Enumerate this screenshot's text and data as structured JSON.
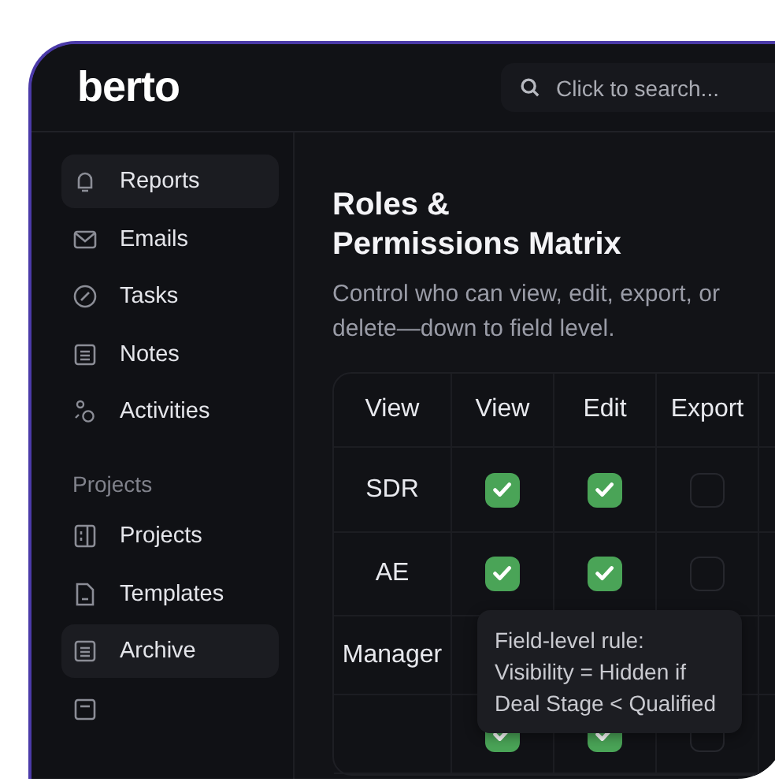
{
  "header": {
    "logo": "berto",
    "search": {
      "placeholder": "Click to search..."
    }
  },
  "sidebar": {
    "items": [
      {
        "label": "Reports",
        "selected": true
      },
      {
        "label": "Emails",
        "selected": false
      },
      {
        "label": "Tasks",
        "selected": false
      },
      {
        "label": "Notes",
        "selected": false
      },
      {
        "label": "Activities",
        "selected": false
      }
    ],
    "section": {
      "title": "Projects",
      "items": [
        {
          "label": "Projects",
          "selected": false
        },
        {
          "label": "Templates",
          "selected": false
        },
        {
          "label": "Archive",
          "selected": true
        },
        {
          "selected": false
        }
      ]
    }
  },
  "main": {
    "title": "Roles &\nPermissions Matrix",
    "description": "Control who can view, edit, export, or delete—down to field level.",
    "table": {
      "columns": [
        "View",
        "View",
        "Edit",
        "Export"
      ],
      "rows": [
        {
          "role": "SDR",
          "cells": [
            {
              "checked": true
            },
            {
              "checked": true
            },
            {
              "checked": false
            }
          ]
        },
        {
          "role": "AE",
          "cells": [
            {
              "checked": true
            },
            {
              "checked": true
            },
            {
              "checked": false
            }
          ]
        },
        {
          "role": "Manager"
        },
        {
          "cells": [
            {
              "checked": true
            },
            {
              "checked": true
            },
            {
              "checked": false
            }
          ]
        }
      ],
      "tooltip": "Field-level rule:\nVisibility = Hidden if\nDeal Stage < Qualified"
    }
  }
}
